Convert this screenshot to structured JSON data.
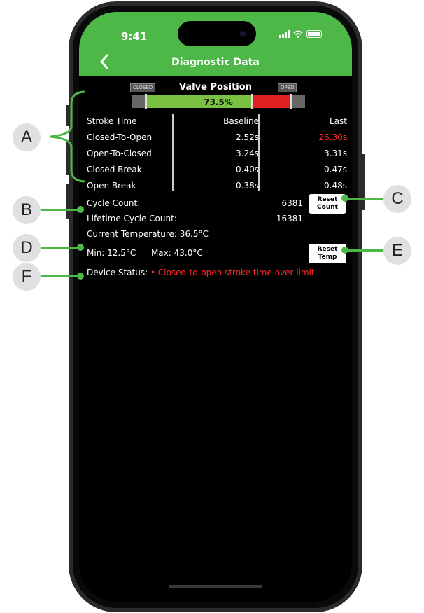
{
  "status_bar": {
    "time": "9:41"
  },
  "header": {
    "title": "Diagnostic Data"
  },
  "valve": {
    "closed_tag": "CLOSED",
    "open_tag": "OPEN",
    "label": "Valve Position",
    "percent_text": "73.5%",
    "position_fraction": 0.735
  },
  "stroke_table": {
    "headers": [
      "Stroke Time",
      "Baseline",
      "Last"
    ],
    "rows": [
      {
        "name": "Closed-To-Open",
        "baseline": "2.52s",
        "last": "26.30s",
        "last_alert": true
      },
      {
        "name": "Open-To-Closed",
        "baseline": "3.24s",
        "last": "3.31s",
        "last_alert": false
      },
      {
        "name": "Closed Break",
        "baseline": "0.40s",
        "last": "0.47s",
        "last_alert": false
      },
      {
        "name": "Open Break",
        "baseline": "0.38s",
        "last": "0.48s",
        "last_alert": false
      }
    ]
  },
  "cycle": {
    "count_label": "Cycle Count:",
    "count_value": "6381",
    "lifetime_label": "Lifetime Cycle Count:",
    "lifetime_value": "16381",
    "reset_label_1": "Reset",
    "reset_label_2": "Count"
  },
  "temperature": {
    "current_label": "Current Temperature:",
    "current_value": "36.5°C",
    "min_label": "Min:",
    "min_value": "12.5°C",
    "max_label": "Max:",
    "max_value": "43.0°C",
    "reset_label_1": "Reset",
    "reset_label_2": "Temp"
  },
  "device_status": {
    "label": "Device Status:",
    "message": "• Closed-to-open stroke time over limit"
  },
  "callouts": {
    "a": "A",
    "b": "B",
    "c": "C",
    "d": "D",
    "e": "E",
    "f": "F"
  },
  "colors": {
    "header_green": "#4db848",
    "bar_green": "#7ac142",
    "alert_red": "#e02020"
  }
}
